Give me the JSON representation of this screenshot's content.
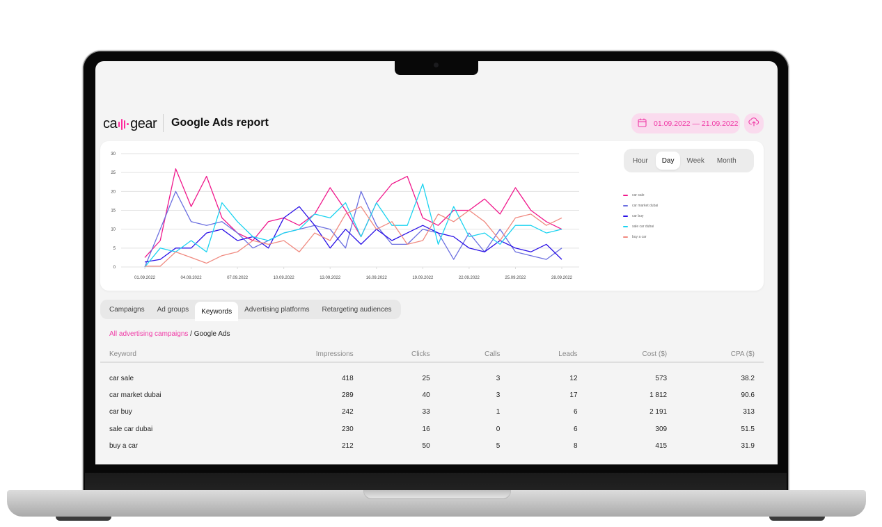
{
  "app": {
    "logo_text_left": "ca",
    "logo_text_right": "gear",
    "report_title": "Google Ads report",
    "date_range": "01.09.2022 — 21.09.2022",
    "icons": {
      "calendar": "calendar-icon",
      "upload": "cloud-upload-icon"
    },
    "accent_color": "#f03aa6"
  },
  "granularity": {
    "options": [
      "Hour",
      "Day",
      "Week",
      "Month"
    ],
    "selected": "Day"
  },
  "tabs": {
    "items": [
      "Campaigns",
      "Ad groups",
      "Keywords",
      "Advertising platforms",
      "Retargeting audiences"
    ],
    "selected": "Keywords"
  },
  "breadcrumb": {
    "link": "All advertising campaigns",
    "separator": " / ",
    "current": "Google Ads"
  },
  "table": {
    "columns": [
      "Keyword",
      "Impressions",
      "Clicks",
      "Calls",
      "Leads",
      "Cost ($)",
      "CPA ($)"
    ],
    "rows": [
      [
        "car sale",
        "418",
        "25",
        "3",
        "12",
        "573",
        "38.2"
      ],
      [
        "car market dubai",
        "289",
        "40",
        "3",
        "17",
        "1 812",
        "90.6"
      ],
      [
        "car buy",
        "242",
        "33",
        "1",
        "6",
        "2 191",
        "313"
      ],
      [
        "sale car dubai",
        "230",
        "16",
        "0",
        "6",
        "309",
        "51.5"
      ],
      [
        "buy a car",
        "212",
        "50",
        "5",
        "8",
        "415",
        "31.9"
      ]
    ]
  },
  "chart_data": {
    "type": "line",
    "title": "",
    "xlabel": "",
    "ylabel": "",
    "ylim": [
      0,
      30
    ],
    "yticks": [
      0,
      5,
      10,
      15,
      20,
      25,
      30
    ],
    "grid": true,
    "legend_position": "right",
    "x": [
      "01.09.2022",
      "02.09.2022",
      "03.09.2022",
      "04.09.2022",
      "05.09.2022",
      "06.09.2022",
      "07.09.2022",
      "08.09.2022",
      "09.09.2022",
      "10.09.2022",
      "11.09.2022",
      "12.09.2022",
      "13.09.2022",
      "14.09.2022",
      "15.09.2022",
      "16.09.2022",
      "17.09.2022",
      "18.09.2022",
      "19.09.2022",
      "20.09.2022",
      "21.09.2022",
      "22.09.2022",
      "23.09.2022",
      "24.09.2022",
      "25.09.2022",
      "26.09.2022",
      "27.09.2022",
      "28.09.2022"
    ],
    "xtick_labels": [
      "01.09.2022",
      "04.09.2022",
      "07.09.2022",
      "10.09.2022",
      "13.09.2022",
      "16.09.2022",
      "19.09.2022",
      "22.09.2022",
      "25.09.2022",
      "28.09.2022"
    ],
    "series": [
      {
        "name": "car sale",
        "color": "#f0188c",
        "values": [
          2.5,
          7,
          26,
          16,
          24,
          13,
          9,
          7,
          12,
          13,
          11,
          14,
          21,
          15,
          8,
          17,
          22,
          24,
          13,
          11,
          15,
          15,
          18,
          14,
          21,
          15,
          12,
          10
        ]
      },
      {
        "name": "car market dubai",
        "color": "#6b6fe0",
        "values": [
          0,
          10,
          20,
          12,
          11,
          12,
          9,
          5,
          7,
          9,
          10,
          11,
          10,
          5,
          20,
          11,
          6,
          6,
          10,
          9,
          2,
          9,
          4,
          10,
          4,
          3,
          2,
          5
        ]
      },
      {
        "name": "car buy",
        "color": "#2a10e6",
        "values": [
          1.3,
          2,
          5,
          5,
          9,
          10,
          7,
          8,
          5,
          13,
          16,
          11,
          5,
          10,
          6,
          10,
          7,
          9,
          11,
          9,
          8,
          5,
          4,
          7,
          5,
          4,
          6,
          2
        ]
      },
      {
        "name": "sale car dubai",
        "color": "#1ad3f0",
        "values": [
          0,
          5,
          4,
          7,
          4,
          17,
          12,
          8,
          7,
          9,
          10,
          14,
          13,
          17,
          8,
          17,
          11,
          11,
          22,
          6,
          16,
          8,
          9,
          6,
          11,
          11,
          9,
          10
        ]
      },
      {
        "name": "buy a car",
        "color": "#f08a80",
        "values": [
          0.2,
          0.2,
          4,
          2.5,
          1,
          3,
          4,
          7,
          6,
          7,
          4,
          9,
          7,
          14,
          16,
          10,
          12,
          6,
          7,
          14,
          12,
          15,
          12,
          7,
          13,
          14,
          11,
          13
        ]
      }
    ]
  }
}
